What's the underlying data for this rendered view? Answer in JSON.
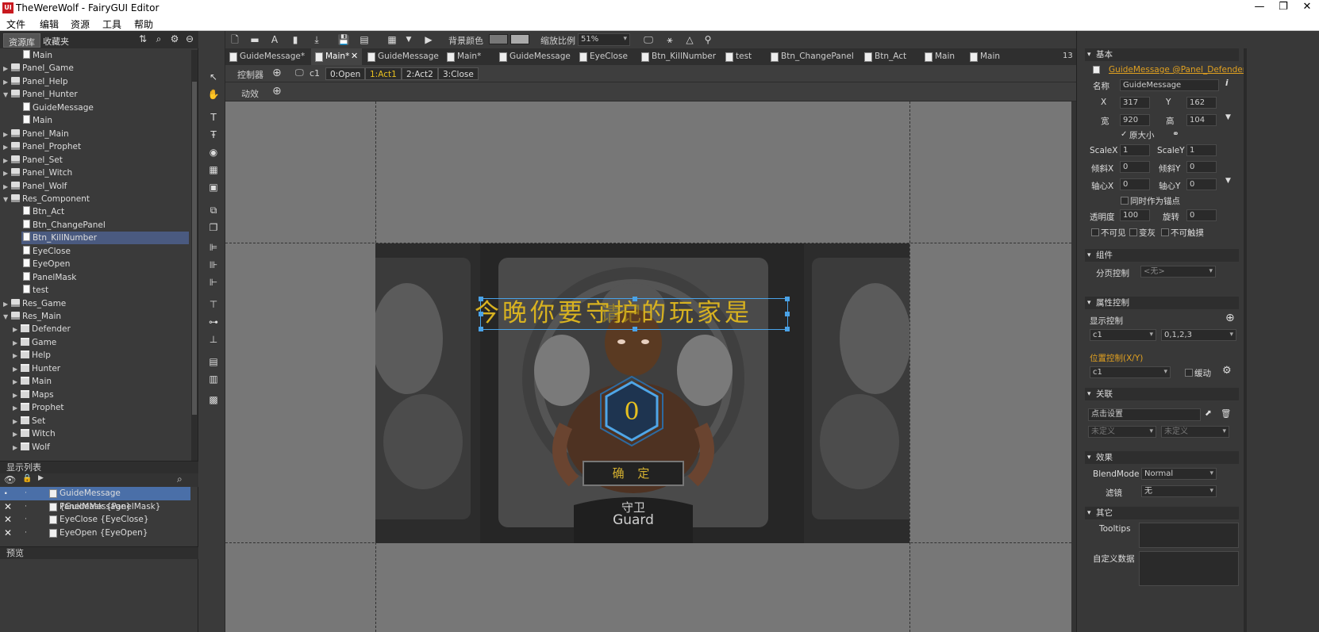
{
  "app": {
    "title": "TheWereWolf - FairyGUI Editor",
    "logo": "UI"
  },
  "menu": [
    "文件",
    "编辑",
    "资源",
    "工具",
    "帮助"
  ],
  "library": {
    "tabs": [
      "资源库",
      "收藏夹"
    ],
    "tree": [
      {
        "label": "Main",
        "type": "doc",
        "depth": 2
      },
      {
        "label": "Panel_Game",
        "type": "pkg",
        "depth": 0,
        "arrow": "▶"
      },
      {
        "label": "Panel_Help",
        "type": "pkg",
        "depth": 0,
        "arrow": "▶"
      },
      {
        "label": "Panel_Hunter",
        "type": "pkg",
        "depth": 0,
        "arrow": "▼"
      },
      {
        "label": "GuideMessage",
        "type": "doc",
        "depth": 2
      },
      {
        "label": "Main",
        "type": "doc",
        "depth": 2
      },
      {
        "label": "Panel_Main",
        "type": "pkg",
        "depth": 0,
        "arrow": "▶"
      },
      {
        "label": "Panel_Prophet",
        "type": "pkg",
        "depth": 0,
        "arrow": "▶"
      },
      {
        "label": "Panel_Set",
        "type": "pkg",
        "depth": 0,
        "arrow": "▶"
      },
      {
        "label": "Panel_Witch",
        "type": "pkg",
        "depth": 0,
        "arrow": "▶"
      },
      {
        "label": "Panel_Wolf",
        "type": "pkg",
        "depth": 0,
        "arrow": "▶"
      },
      {
        "label": "Res_Component",
        "type": "pkg",
        "depth": 0,
        "arrow": "▼"
      },
      {
        "label": "Btn_Act",
        "type": "doc",
        "depth": 2
      },
      {
        "label": "Btn_ChangePanel",
        "type": "doc",
        "depth": 2
      },
      {
        "label": "Btn_KillNumber",
        "type": "doc",
        "depth": 2,
        "selected": true
      },
      {
        "label": "EyeClose",
        "type": "doc",
        "depth": 2
      },
      {
        "label": "EyeOpen",
        "type": "doc",
        "depth": 2
      },
      {
        "label": "PanelMask",
        "type": "doc",
        "depth": 2
      },
      {
        "label": "test",
        "type": "doc",
        "depth": 2
      },
      {
        "label": "Res_Game",
        "type": "pkg",
        "depth": 0,
        "arrow": "▶"
      },
      {
        "label": "Res_Main",
        "type": "pkg",
        "depth": 0,
        "arrow": "▼"
      },
      {
        "label": "Defender",
        "type": "fld",
        "depth": 1,
        "arrow": "▶"
      },
      {
        "label": "Game",
        "type": "fld",
        "depth": 1,
        "arrow": "▶"
      },
      {
        "label": "Help",
        "type": "fld",
        "depth": 1,
        "arrow": "▶"
      },
      {
        "label": "Hunter",
        "type": "fld",
        "depth": 1,
        "arrow": "▶"
      },
      {
        "label": "Main",
        "type": "fld",
        "depth": 1,
        "arrow": "▶"
      },
      {
        "label": "Maps",
        "type": "fld",
        "depth": 1,
        "arrow": "▶"
      },
      {
        "label": "Prophet",
        "type": "fld",
        "depth": 1,
        "arrow": "▶"
      },
      {
        "label": "Set",
        "type": "fld",
        "depth": 1,
        "arrow": "▶"
      },
      {
        "label": "Witch",
        "type": "fld",
        "depth": 1,
        "arrow": "▶"
      },
      {
        "label": "Wolf",
        "type": "fld",
        "depth": 1,
        "arrow": "▶"
      }
    ]
  },
  "displaylist": {
    "title": "显示列表",
    "rows": [
      {
        "label": "GuideMessage {GuideMessage}",
        "mark": "·",
        "selected": true
      },
      {
        "label": "PanelMask {PanelMask}",
        "mark": "✕"
      },
      {
        "label": "EyeClose {EyeClose}",
        "mark": "✕"
      },
      {
        "label": "EyeOpen {EyeOpen}",
        "mark": "✕"
      }
    ]
  },
  "preview": {
    "title": "预览"
  },
  "toolbar": {
    "bg_label": "背景颜色",
    "zoom_label": "缩放比例",
    "zoom_value": "51%"
  },
  "doctabs": [
    "GuideMessage*",
    "Main*",
    "GuideMessage",
    "Main*",
    "GuideMessage",
    "EyeClose",
    "Btn_KillNumber",
    "test",
    "Btn_ChangePanel",
    "Btn_Act",
    "Main",
    "Main"
  ],
  "doctab_count": "13",
  "controller": {
    "label": "控制器",
    "name": "c1",
    "pages": [
      "0:Open",
      "1:Act1",
      "2:Act2",
      "3:Close"
    ],
    "active": 1
  },
  "transition": {
    "label": "动效"
  },
  "stage": {
    "message": "今晚你要守护的玩家是",
    "overlay": "请记",
    "counter": "0",
    "confirm": "确 定",
    "role_cn": "守卫",
    "role_en": "Guard"
  },
  "props": {
    "basic": {
      "title": "基本",
      "object": "GuideMessage @Panel_Defender",
      "name_label": "名称",
      "name": "GuideMessage",
      "x_label": "X",
      "x": "317",
      "y_label": "Y",
      "y": "162",
      "w_label": "宽",
      "w": "920",
      "h_label": "高",
      "h": "104",
      "orig_size": "原大小",
      "scalex_label": "ScaleX",
      "scalex": "1",
      "scaley_label": "ScaleY",
      "scaley": "1",
      "skewx_label": "倾斜X",
      "skewx": "0",
      "skewy_label": "倾斜Y",
      "skewy": "0",
      "pivotx_label": "轴心X",
      "pivotx": "0",
      "pivoty_label": "轴心Y",
      "pivoty": "0",
      "anchor": "同时作为锚点",
      "alpha_label": "透明度",
      "alpha": "100",
      "rot_label": "旋转",
      "rot": "0",
      "invisible": "不可见",
      "gray": "变灰",
      "untouchable": "不可触摸"
    },
    "component": {
      "title": "组件",
      "page_ctrl_label": "分页控制",
      "page_ctrl": "<无>"
    },
    "gear": {
      "title": "属性控制",
      "display_label": "显示控制",
      "display_ctrl": "c1",
      "display_pages": "0,1,2,3",
      "pos_label": "位置控制(X/Y)",
      "pos_ctrl": "c1",
      "tween": "缓动"
    },
    "relation": {
      "title": "关联",
      "click": "点击设置",
      "undef1": "未定义",
      "undef2": "未定义"
    },
    "effect": {
      "title": "效果",
      "blend_label": "BlendMode",
      "blend": "Normal",
      "filter_label": "滤镜",
      "filter": "无"
    },
    "other": {
      "title": "其它",
      "tooltips_label": "Tooltips",
      "custom_label": "自定义数据"
    }
  },
  "colors": {
    "accent": "#e8c020",
    "selection": "#4a6fa8",
    "link": "#e0a020"
  }
}
